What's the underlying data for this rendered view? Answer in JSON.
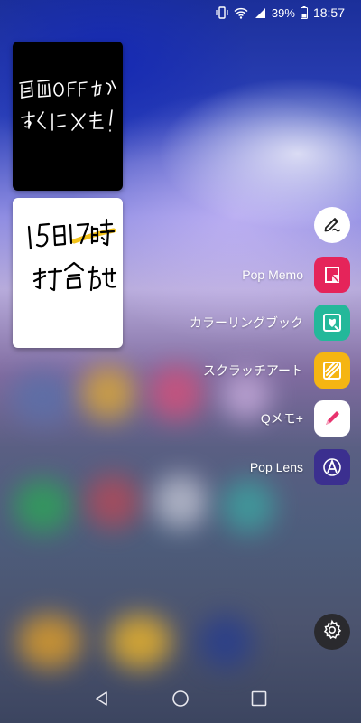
{
  "status_bar": {
    "battery_percent": "39%",
    "time": "18:57",
    "icons": [
      "vibrate-icon",
      "wifi-icon",
      "signal-icon",
      "battery-icon"
    ]
  },
  "memos": [
    {
      "name": "memo-card-screen-off",
      "theme": "dark",
      "handwriting": "画面OFFから すぐにメモ!"
    },
    {
      "name": "memo-card-meeting",
      "theme": "light",
      "handwriting": "15日17時 打合わせ"
    }
  ],
  "menu": {
    "top_button_icon": "pen-write-icon",
    "items": [
      {
        "label": "Pop Memo",
        "icon": "pop-memo-icon",
        "color": "#e5245a"
      },
      {
        "label": "カラーリングブック",
        "icon": "coloring-book-icon",
        "color": "#23b89a"
      },
      {
        "label": "スクラッチアート",
        "icon": "scratch-art-icon",
        "color": "#f5b512"
      },
      {
        "label": "Qメモ+",
        "icon": "qmemo-pen-icon",
        "color": "#ffffff"
      },
      {
        "label": "Pop Lens",
        "icon": "pop-lens-icon",
        "color": "#3b2f8f"
      }
    ],
    "settings_icon": "gear-icon"
  },
  "nav": {
    "back": "back-icon",
    "home": "home-icon",
    "recents": "recents-icon"
  }
}
